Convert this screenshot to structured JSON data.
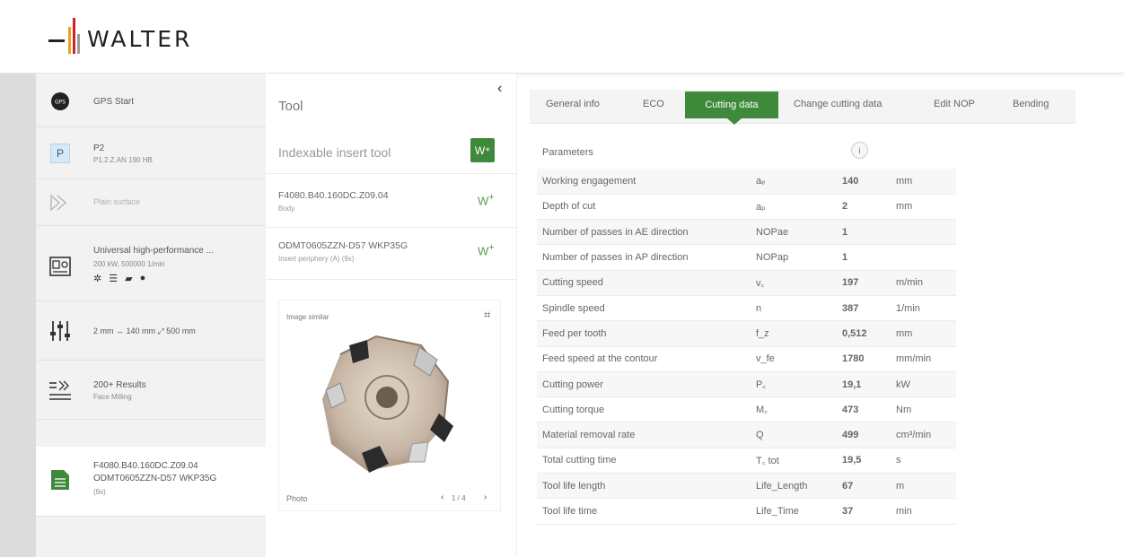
{
  "header": {
    "logo_text": "WALTER",
    "logo_colors": [
      "#e8a317",
      "#d2232a",
      "#9b9b9b"
    ]
  },
  "workflow": {
    "items": [
      {
        "title": "GPS Start",
        "sub": "",
        "icon": "gps-start-icon"
      },
      {
        "title": "P2",
        "sub": "P1.2.Z.AN  190 HB",
        "badge": "P",
        "icon": "material-badge-icon"
      },
      {
        "title": "Plain surface",
        "sub": "",
        "icon": "plain-surface-icon"
      },
      {
        "title": "Universal high-performance ...",
        "sub": "200 kW, 500000 1/min",
        "icon": "machine-icon",
        "icons_row": "machine-options-icons"
      },
      {
        "title": "2 mm ↔ 140 mm ⤢ 500 mm",
        "sub": "",
        "icon": "sliders-icon"
      },
      {
        "title": "200+ Results",
        "sub": "Face Milling",
        "icon": "results-icon"
      },
      {
        "title": "F4080.B40.160DC.Z09.04",
        "sub": "ODMT0605ZZN-D57 WKP35G",
        "sub2": "(9x)",
        "icon": "tool-selected-icon"
      }
    ]
  },
  "tool": {
    "title": "Tool",
    "collapse": "‹",
    "indexable": "Indexable insert tool",
    "body_code": "F4080.B40.160DC.Z09.04",
    "body_label": "Body",
    "insert_code": "ODMT0605ZZN-D57 WKP35G",
    "insert_label": "Insert periphery (A) (9x)",
    "image_label": "Image similar",
    "photo_label": "Photo",
    "pager": "1 / 4"
  },
  "tabs": {
    "items": [
      "General info",
      "ECO",
      "Cutting data",
      "Change cutting data",
      "Edit NOP",
      "Bending"
    ],
    "active": "Cutting data"
  },
  "params": {
    "header": "Parameters",
    "info": "i",
    "rows": [
      {
        "name": "Working engagement",
        "symbol": "aₑ",
        "value": "140",
        "unit": "mm"
      },
      {
        "name": "Depth of cut",
        "symbol": "aₚ",
        "value": "2",
        "unit": "mm"
      },
      {
        "name": "Number of passes in AE direction",
        "symbol": "NOPae",
        "value": "1",
        "unit": ""
      },
      {
        "name": "Number of passes in AP direction",
        "symbol": "NOPap",
        "value": "1",
        "unit": ""
      },
      {
        "name": "Cutting speed",
        "symbol": "v꜀",
        "value": "197",
        "unit": "m/min"
      },
      {
        "name": "Spindle speed",
        "symbol": "n",
        "value": "387",
        "unit": "1/min"
      },
      {
        "name": "Feed per tooth",
        "symbol": "f_z",
        "value": "0,512",
        "unit": "mm"
      },
      {
        "name": "Feed speed at the contour",
        "symbol": "v_fe",
        "value": "1780",
        "unit": "mm/min"
      },
      {
        "name": "Cutting power",
        "symbol": "P꜀",
        "value": "19,1",
        "unit": "kW"
      },
      {
        "name": "Cutting torque",
        "symbol": "M꜀",
        "value": "473",
        "unit": "Nm"
      },
      {
        "name": "Material removal rate",
        "symbol": "Q",
        "value": "499",
        "unit": "cm³/min"
      },
      {
        "name": "Total cutting time",
        "symbol": "T꜀ tot",
        "value": "19,5",
        "unit": "s"
      },
      {
        "name": "Tool life length",
        "symbol": "Life_Length",
        "value": "67",
        "unit": "m"
      },
      {
        "name": "Tool life time",
        "symbol": "Life_Time",
        "value": "37",
        "unit": "min"
      }
    ]
  }
}
